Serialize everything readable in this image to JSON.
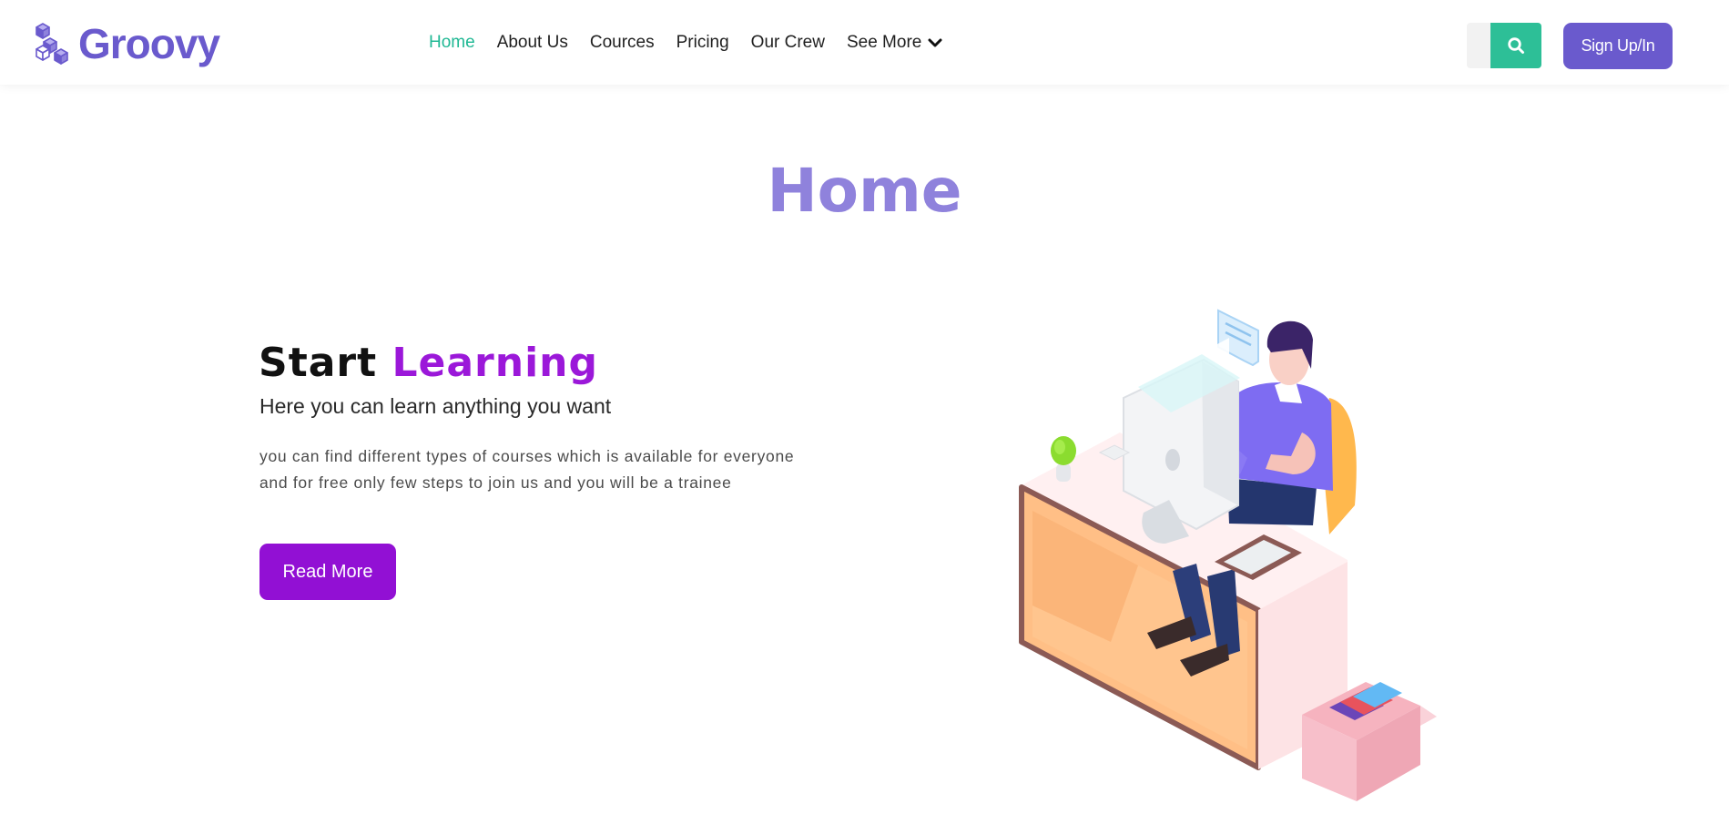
{
  "navbar": {
    "brand": {
      "name": "Groovy",
      "icon": "cubes-logo-icon"
    },
    "links": [
      {
        "label": "Home",
        "active": true
      },
      {
        "label": "About Us",
        "active": false
      },
      {
        "label": "Cources",
        "active": false
      },
      {
        "label": "Pricing",
        "active": false
      },
      {
        "label": "Our Crew",
        "active": false
      }
    ],
    "dropdown": {
      "label": "See More",
      "icon": "chevron-down-icon"
    },
    "search": {
      "placeholder": "",
      "icon": "search-icon"
    },
    "signup_label": "Sign Up/In"
  },
  "page": {
    "title": "Home"
  },
  "hero": {
    "heading_part1": "Start",
    "heading_part2": "Learning",
    "subheading": "Here you can learn anything you want",
    "description_line1": "you can find different types of courses which is available for everyone",
    "description_line2": "and for free only few steps to join us and you will be a trainee",
    "button_label": "Read More"
  },
  "colors": {
    "brand": "#6a5acd",
    "nav_active": "#20b894",
    "search_button": "#2dbf97",
    "title": "#8f82dc",
    "accent": "#9b18d9",
    "read_more": "#9210d4"
  }
}
